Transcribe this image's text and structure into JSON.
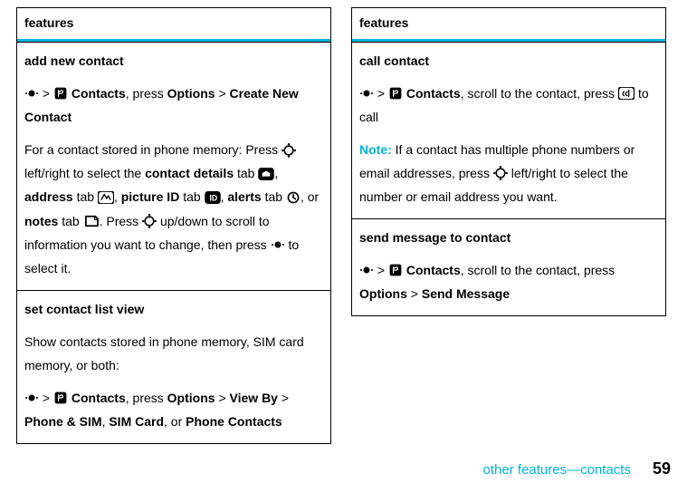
{
  "left": {
    "header": "features",
    "sec1": {
      "title": "add new contact",
      "gt1": ">",
      "contacts": "Contacts",
      "press1": ", press ",
      "options": "Options",
      "gt2": " > ",
      "create": "Create New Contact",
      "p2a": "For a contact stored in phone memory: Press ",
      "p2b": " left/right to select the ",
      "cd": "contact details",
      "p2c": " tab ",
      "p2d": ", ",
      "addr": "address",
      "p2e": " tab ",
      "p2f": ", ",
      "pid": "picture ID",
      "p2g": " tab ",
      "p2h": ", ",
      "alerts": "alerts",
      "p2i": " tab ",
      "p2j": ", or ",
      "notes": "notes",
      "p2k": " tab ",
      "p2l": ". Press ",
      "p2m": " up/down to scroll to information you want to change, then press ",
      "p2n": " to select it."
    },
    "sec2": {
      "title": "set contact list view",
      "p1": "Show contacts stored in phone memory, SIM card memory, or both:",
      "gt1": ">",
      "contacts": "Contacts",
      "press1": ", press ",
      "options": "Options",
      "gt2": " > ",
      "viewby": "View By",
      "gt3": " > ",
      "ps": "Phone & SIM",
      "c1": ", ",
      "sim": "SIM Card",
      "or": ", or ",
      "pc": "Phone Contacts"
    }
  },
  "right": {
    "header": "features",
    "sec1": {
      "title": "call contact",
      "gt1": ">",
      "contacts": "Contacts",
      "p1a": ", scroll to the contact, press ",
      "p1b": " to call",
      "note": "Note: ",
      "p2a": "If a contact has multiple phone numbers or email addresses, press ",
      "p2b": " left/right to select the number or email address you want."
    },
    "sec2": {
      "title": "send message to contact",
      "gt1": ">",
      "contacts": "Contacts",
      "p1a": ", scroll to the contact, press ",
      "options": "Options",
      "gt2": " > ",
      "send": "Send Message"
    }
  },
  "footer": {
    "crumb": "other features—contacts",
    "page": "59"
  }
}
